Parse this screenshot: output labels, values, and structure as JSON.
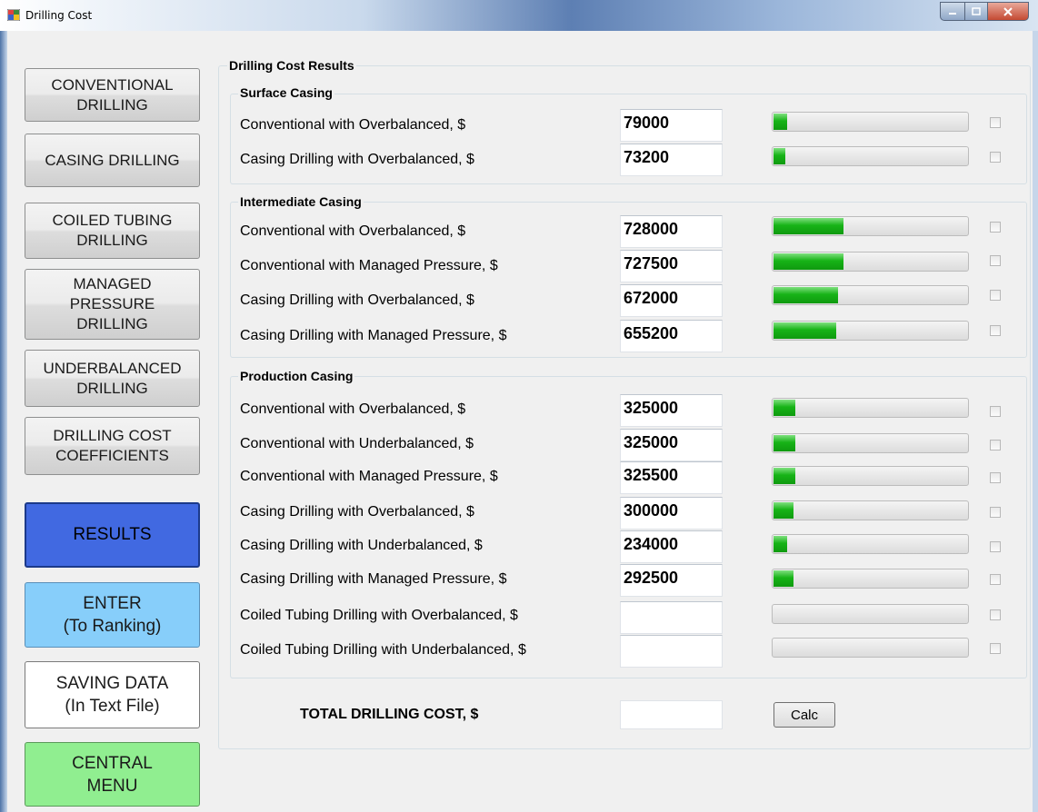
{
  "window": {
    "title": "Drilling Cost"
  },
  "nav": {
    "conventional": "CONVENTIONAL\nDRILLING",
    "casing": "CASING DRILLING",
    "coiled": "COILED TUBING\nDRILLING",
    "managed": "MANAGED\nPRESSURE\nDRILLING",
    "underbalanced": "UNDERBALANCED\nDRILLING",
    "coefficients": "DRILLING COST\nCOEFFICIENTS",
    "results": "RESULTS",
    "enter": "ENTER\n(To Ranking)",
    "saving": "SAVING DATA\n(In Text File)",
    "central": "CENTRAL\nMENU"
  },
  "results": {
    "title": "Drilling Cost Results",
    "surface": {
      "title": "Surface Casing",
      "rows": [
        {
          "label": "Conventional with Overbalanced, $",
          "value": "79000",
          "progress": 0.07
        },
        {
          "label": "Casing Drilling with Overbalanced, $",
          "value": "73200",
          "progress": 0.06
        }
      ]
    },
    "intermediate": {
      "title": "Intermediate Casing",
      "rows": [
        {
          "label": "Conventional with Overbalanced, $",
          "value": "728000",
          "progress": 0.36
        },
        {
          "label": "Conventional with Managed Pressure, $",
          "value": "727500",
          "progress": 0.36
        },
        {
          "label": "Casing Drilling with Overbalanced, $",
          "value": "672000",
          "progress": 0.33
        },
        {
          "label": "Casing Drilling with Managed Pressure, $",
          "value": "655200",
          "progress": 0.32
        }
      ]
    },
    "production": {
      "title": "Production Casing",
      "rows": [
        {
          "label": "Conventional with Overbalanced, $",
          "value": "325000",
          "progress": 0.11
        },
        {
          "label": "Conventional with Underbalanced, $",
          "value": "325000",
          "progress": 0.11
        },
        {
          "label": "Conventional with Managed Pressure, $",
          "value": "325500",
          "progress": 0.11
        },
        {
          "label": "Casing Drilling with Overbalanced, $",
          "value": "300000",
          "progress": 0.1
        },
        {
          "label": "Casing Drilling with Underbalanced, $",
          "value": "234000",
          "progress": 0.07
        },
        {
          "label": "Casing Drilling with Managed Pressure, $",
          "value": "292500",
          "progress": 0.1
        },
        {
          "label": "Coiled Tubing Drilling with Overbalanced, $",
          "value": "",
          "progress": 0
        },
        {
          "label": "Coiled Tubing Drilling with Underbalanced, $",
          "value": "",
          "progress": 0
        }
      ]
    },
    "total_label": "TOTAL DRILLING COST, $",
    "total_value": "",
    "calc_label": "Calc"
  },
  "colors": {
    "results_button": "#4169e1",
    "enter_button": "#87cefa",
    "central_button": "#90ee90",
    "progress_fill": "#17b317"
  }
}
